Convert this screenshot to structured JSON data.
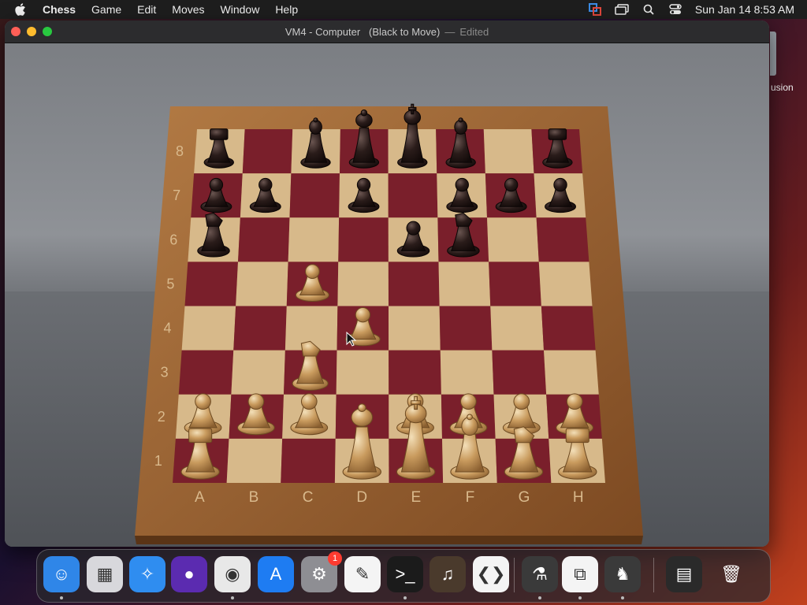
{
  "menubar": {
    "app_name": "Chess",
    "menus": [
      "Game",
      "Edit",
      "Moves",
      "Window",
      "Help"
    ],
    "clock": "Sun Jan 14  8:53 AM"
  },
  "desktop": {
    "right_label": "usion"
  },
  "window": {
    "title": "VM4 - Computer   (Black to Move)",
    "dash": "—",
    "edited": "Edited"
  },
  "board": {
    "files": [
      "A",
      "B",
      "C",
      "D",
      "E",
      "F",
      "G",
      "H"
    ],
    "ranks": [
      "8",
      "7",
      "6",
      "5",
      "4",
      "3",
      "2",
      "1"
    ],
    "light_color": "#d7b98a",
    "dark_color": "#7a1f2b",
    "frame_color": "#9a6434",
    "pieces": [
      {
        "sq": "a8",
        "color": "black",
        "type": "rook"
      },
      {
        "sq": "c8",
        "color": "black",
        "type": "bishop"
      },
      {
        "sq": "d8",
        "color": "black",
        "type": "queen"
      },
      {
        "sq": "e8",
        "color": "black",
        "type": "king"
      },
      {
        "sq": "f8",
        "color": "black",
        "type": "bishop"
      },
      {
        "sq": "h8",
        "color": "black",
        "type": "rook"
      },
      {
        "sq": "a7",
        "color": "black",
        "type": "pawn"
      },
      {
        "sq": "b7",
        "color": "black",
        "type": "pawn"
      },
      {
        "sq": "d7",
        "color": "black",
        "type": "pawn"
      },
      {
        "sq": "f7",
        "color": "black",
        "type": "pawn"
      },
      {
        "sq": "g7",
        "color": "black",
        "type": "pawn"
      },
      {
        "sq": "h7",
        "color": "black",
        "type": "pawn"
      },
      {
        "sq": "a6",
        "color": "black",
        "type": "knight"
      },
      {
        "sq": "e6",
        "color": "black",
        "type": "pawn"
      },
      {
        "sq": "f6",
        "color": "black",
        "type": "knight"
      },
      {
        "sq": "c5",
        "color": "white",
        "type": "pawn"
      },
      {
        "sq": "d4",
        "color": "white",
        "type": "pawn"
      },
      {
        "sq": "c3",
        "color": "white",
        "type": "knight"
      },
      {
        "sq": "a2",
        "color": "white",
        "type": "pawn"
      },
      {
        "sq": "b2",
        "color": "white",
        "type": "pawn"
      },
      {
        "sq": "c2",
        "color": "white",
        "type": "pawn"
      },
      {
        "sq": "e2",
        "color": "white",
        "type": "pawn"
      },
      {
        "sq": "f2",
        "color": "white",
        "type": "pawn"
      },
      {
        "sq": "g2",
        "color": "white",
        "type": "pawn"
      },
      {
        "sq": "h2",
        "color": "white",
        "type": "pawn"
      },
      {
        "sq": "a1",
        "color": "white",
        "type": "rook"
      },
      {
        "sq": "d1",
        "color": "white",
        "type": "queen"
      },
      {
        "sq": "e1",
        "color": "white",
        "type": "king"
      },
      {
        "sq": "f1",
        "color": "white",
        "type": "bishop"
      },
      {
        "sq": "g1",
        "color": "white",
        "type": "knight"
      },
      {
        "sq": "h1",
        "color": "white",
        "type": "rook"
      }
    ]
  },
  "dock": {
    "items": [
      {
        "name": "finder-icon",
        "bg": "#2f86e8",
        "glyph": "☺",
        "dot": true
      },
      {
        "name": "launchpad-icon",
        "bg": "#d8d8dc",
        "glyph": "▦",
        "dot": false
      },
      {
        "name": "safari-icon",
        "bg": "#2f8df0",
        "glyph": "✧",
        "dot": false
      },
      {
        "name": "firefox-icon",
        "bg": "#5b2bb0",
        "glyph": "●",
        "dot": false
      },
      {
        "name": "chrome-icon",
        "bg": "#e8e8e8",
        "glyph": "◉",
        "dot": true
      },
      {
        "name": "app-store-icon",
        "bg": "#1e7cf2",
        "glyph": "A",
        "dot": false
      },
      {
        "name": "system-settings-icon",
        "bg": "#8e8e93",
        "glyph": "⚙",
        "dot": false,
        "badge": "1"
      },
      {
        "name": "textedit-icon",
        "bg": "#f4f4f4",
        "glyph": "✎",
        "dot": false
      },
      {
        "name": "terminal-icon",
        "bg": "#1b1b1b",
        "glyph": ">_",
        "dot": true
      },
      {
        "name": "garageband-icon",
        "bg": "#4a3a2c",
        "glyph": "♫",
        "dot": false
      },
      {
        "name": "vscode-icon",
        "bg": "#f4f4f4",
        "glyph": "❮❯",
        "dot": false
      },
      {
        "name": "installer-icon",
        "bg": "#3a3a3a",
        "glyph": "⚗",
        "dot": true
      },
      {
        "name": "vmware-icon",
        "bg": "#f4f4f4",
        "glyph": "⧉",
        "dot": true
      },
      {
        "name": "chess-icon",
        "bg": "#3a3a3a",
        "glyph": "♞",
        "dot": true
      },
      {
        "name": "downloads-stack-icon",
        "bg": "#2a2a2a",
        "glyph": "▤",
        "dot": false
      },
      {
        "name": "trash-icon",
        "bg": "transparent",
        "glyph": "🗑",
        "dot": false
      }
    ]
  }
}
